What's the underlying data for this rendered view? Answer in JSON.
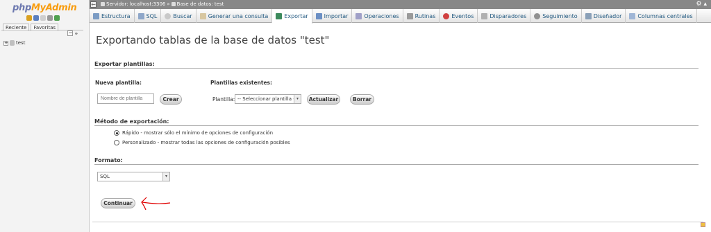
{
  "nav": {
    "logo_php": "php",
    "logo_myadmin": "MyAdmin",
    "tabs": [
      "Reciente",
      "Favoritas"
    ],
    "databases": [
      "test"
    ]
  },
  "breadcrumb": {
    "server": "Servidor: localhost:3306",
    "sep": "»",
    "database": "Base de datos: test"
  },
  "tabs": [
    {
      "label": "Estructura",
      "icon": "structure-icon"
    },
    {
      "label": "SQL",
      "icon": "sql-icon"
    },
    {
      "label": "Buscar",
      "icon": "search-icon"
    },
    {
      "label": "Generar una consulta",
      "icon": "query-icon"
    },
    {
      "label": "Exportar",
      "icon": "export-icon",
      "active": true
    },
    {
      "label": "Importar",
      "icon": "import-icon"
    },
    {
      "label": "Operaciones",
      "icon": "operations-icon"
    },
    {
      "label": "Rutinas",
      "icon": "routines-icon"
    },
    {
      "label": "Eventos",
      "icon": "events-icon"
    },
    {
      "label": "Disparadores",
      "icon": "triggers-icon"
    },
    {
      "label": "Seguimiento",
      "icon": "tracking-icon"
    },
    {
      "label": "Diseñador",
      "icon": "designer-icon"
    },
    {
      "label": "Columnas centrales",
      "icon": "central-columns-icon"
    }
  ],
  "main": {
    "title": "Exportando tablas de la base de datos \"test\"",
    "templates": {
      "heading": "Exportar plantillas:",
      "new_label": "Nueva plantilla:",
      "new_placeholder": "Nombre de plantilla",
      "create_button": "Crear",
      "existing_label": "Plantillas existentes:",
      "template_label": "Plantilla:",
      "template_selected": "-- Seleccionar plantilla --",
      "update_button": "Actualizar",
      "delete_button": "Borrar"
    },
    "method": {
      "heading": "Método de exportación:",
      "options": [
        {
          "label": "Rápido - mostrar sólo el mínimo de opciones de configuración",
          "checked": true
        },
        {
          "label": "Personalizado - mostrar todas las opciones de configuración posibles",
          "checked": false
        }
      ]
    },
    "format": {
      "heading": "Formato:",
      "selected": "SQL"
    },
    "continue_button": "Continuar"
  },
  "colors": {
    "tab_text": "#235a81",
    "logo_php": "#6c78af",
    "logo_myadmin": "#f89c0e",
    "annotation": "#e00000"
  }
}
